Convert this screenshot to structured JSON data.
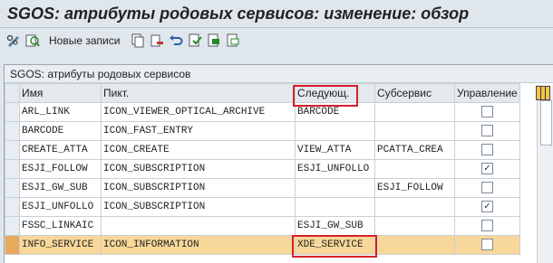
{
  "window": {
    "title": "SGOS: атрибуты родовых сервисов: изменение: обзор"
  },
  "toolbar": {
    "new_entries_label": "Новые записи"
  },
  "panel": {
    "title": "SGOS: атрибуты родовых сервисов"
  },
  "table": {
    "columns": [
      "Имя",
      "Пикт.",
      "Следующ.",
      "Субсервис",
      "Управление"
    ],
    "rows": [
      {
        "name": "ARL_LINK",
        "icon": "ICON_VIEWER_OPTICAL_ARCHIVE",
        "next": "BARCODE",
        "sub": "",
        "control": false
      },
      {
        "name": "BARCODE",
        "icon": "ICON_FAST_ENTRY",
        "next": "",
        "sub": "",
        "control": false
      },
      {
        "name": "CREATE_ATTA",
        "icon": "ICON_CREATE",
        "next": "VIEW_ATTA",
        "sub": "PCATTA_CREA",
        "control": false
      },
      {
        "name": "ESJI_FOLLOW",
        "icon": "ICON_SUBSCRIPTION",
        "next": "ESJI_UNFOLLO",
        "sub": "",
        "control": true
      },
      {
        "name": "ESJI_GW_SUB",
        "icon": "ICON_SUBSCRIPTION",
        "next": "",
        "sub": "ESJI_FOLLOW",
        "control": false
      },
      {
        "name": "ESJI_UNFOLLO",
        "icon": "ICON_SUBSCRIPTION",
        "next": "",
        "sub": "",
        "control": true
      },
      {
        "name": "FSSC_LINKAIC",
        "icon": "",
        "next": "ESJI_GW_SUB",
        "sub": "",
        "control": false
      },
      {
        "name": "INFO_SERVICE",
        "icon": "ICON_INFORMATION",
        "next": "XDE_SERVICE",
        "sub": "",
        "control": false
      }
    ]
  },
  "colors": {
    "highlight_row": "#f8d89a",
    "annotation_box": "#d6202a"
  }
}
